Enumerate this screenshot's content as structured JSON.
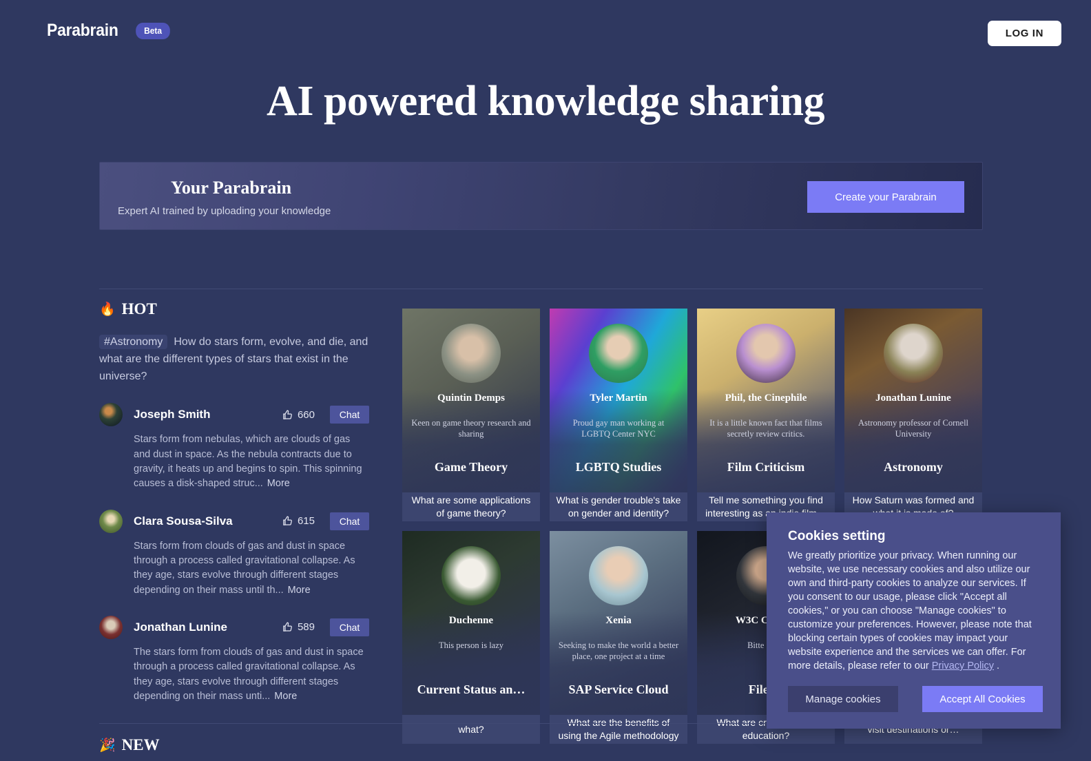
{
  "header": {
    "brand": "Parabrain",
    "badge": "Beta",
    "login_label": "LOG IN"
  },
  "hero": {
    "title": "AI powered knowledge sharing"
  },
  "banner": {
    "title": "Your Parabrain",
    "subtitle": "Expert AI trained by uploading your knowledge",
    "cta_label": "Create your Parabrain"
  },
  "sections": {
    "hot": {
      "emoji": "🔥",
      "label": "HOT"
    },
    "new": {
      "emoji": "🎉",
      "label": "NEW"
    }
  },
  "hot_question": {
    "tag": "#Astronomy",
    "text": "How do stars form, evolve, and die, and what are the different types of stars that exist in the universe?"
  },
  "answers": [
    {
      "name": "Joseph Smith",
      "likes": "660",
      "chat_label": "Chat",
      "body": "Stars form from nebulas, which are clouds of gas and dust in space. As the nebula contracts due to gravity, it heats up and begins to spin. This spinning causes a disk-shaped struc...",
      "more_label": "More"
    },
    {
      "name": "Clara Sousa-Silva",
      "likes": "615",
      "chat_label": "Chat",
      "body": "Stars form from clouds of gas and dust in space through a process called gravitational collapse. As they age, stars evolve through different stages depending on their mass until th...",
      "more_label": "More"
    },
    {
      "name": "Jonathan Lunine",
      "likes": "589",
      "chat_label": "Chat",
      "body": "The stars form from clouds of gas and dust in space through a process called gravitational collapse. As they age, stars evolve through different stages depending on their mass unti...",
      "more_label": "More"
    }
  ],
  "cards": [
    {
      "name": "Quintin Demps",
      "desc": "Keen on game theory research and sharing",
      "topic": "Game Theory",
      "question": "What are some applications of game theory?"
    },
    {
      "name": "Tyler Martin",
      "desc": "Proud gay man working at LGBTQ Center NYC",
      "topic": "LGBTQ Studies",
      "question": "What is gender trouble's take on gender and identity?"
    },
    {
      "name": "Phil, the Cinephile",
      "desc": "It is a little known fact that films secretly review critics.",
      "topic": "Film Criticism",
      "question": "Tell me something you find interesting as an indie film…"
    },
    {
      "name": "Jonathan Lunine",
      "desc": "Astronomy professor of Cornell University",
      "topic": "Astronomy",
      "question": "How Saturn was formed and what it is made of?"
    },
    {
      "name": "Duchenne",
      "desc": "This person is lazy",
      "topic": "Current Status an…",
      "question": "what?"
    },
    {
      "name": "Xenia",
      "desc": "Seeking to make the world a better place, one project at a time",
      "topic": "SAP Service Cloud",
      "question": "What are the benefits of using the Agile methodology"
    },
    {
      "name": "W3C CCG M",
      "desc": "Bitte stelle",
      "topic": "File co",
      "question": "What are credentials in education?"
    },
    {
      "name": "",
      "desc": "",
      "topic": "",
      "question": "visit destinations or…"
    }
  ],
  "cookie": {
    "title": "Cookies setting",
    "body_before_link": "We greatly prioritize your privacy. When running our website, we use necessary cookies and also utilize our own and third-party cookies to analyze our services. If you consent to our usage, please click \"Accept all cookies,\" or you can choose \"Manage cookies\" to customize your preferences. However, please note that blocking certain types of cookies may impact your website experience and the services we can offer. For more details, please refer to our ",
    "link_label": "Privacy Policy",
    "body_after_link": " .",
    "manage_label": "Manage cookies",
    "accept_label": "Accept All Cookies"
  },
  "colors": {
    "page_bg": "#2f3860",
    "accent": "#7b7bf5",
    "badge": "#4e53b8",
    "chat_btn": "#4d549c",
    "question_bar": "#3c456f",
    "cookie_bg": "#4a4f8a"
  }
}
